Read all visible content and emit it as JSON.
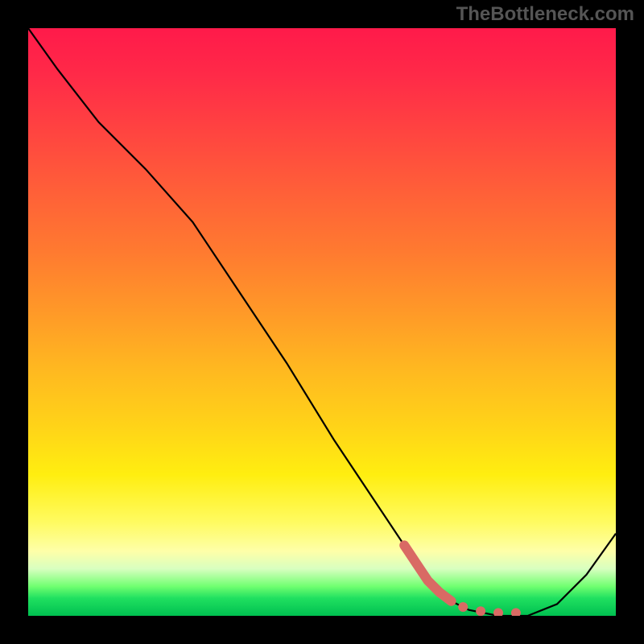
{
  "watermark": "TheBottleneck.com",
  "chart_data": {
    "type": "line",
    "title": "",
    "xlabel": "",
    "ylabel": "",
    "xlim": [
      0,
      100
    ],
    "ylim": [
      0,
      100
    ],
    "grid": false,
    "series": [
      {
        "name": "bottleneck-curve",
        "x": [
          0,
          5,
          12,
          20,
          28,
          36,
          44,
          52,
          60,
          66,
          71,
          75,
          80,
          85,
          90,
          95,
          100
        ],
        "y": [
          100,
          93,
          84,
          76,
          67,
          55,
          43,
          30,
          18,
          9,
          3,
          1,
          0,
          0,
          2,
          7,
          14
        ]
      }
    ],
    "highlight": {
      "name": "optimal-range",
      "color": "#d96a64",
      "points": [
        {
          "x": 64,
          "y": 12
        },
        {
          "x": 66,
          "y": 9
        },
        {
          "x": 68,
          "y": 6
        },
        {
          "x": 70,
          "y": 4
        },
        {
          "x": 72,
          "y": 2.5
        },
        {
          "x": 74,
          "y": 1.5
        },
        {
          "x": 77,
          "y": 0.8
        },
        {
          "x": 80,
          "y": 0.5
        },
        {
          "x": 83,
          "y": 0.5
        }
      ]
    },
    "gradient_stops": [
      {
        "pos": 0,
        "color": "#ff1a4a"
      },
      {
        "pos": 50,
        "color": "#ffb820"
      },
      {
        "pos": 85,
        "color": "#feffa8"
      },
      {
        "pos": 100,
        "color": "#00c050"
      }
    ]
  }
}
